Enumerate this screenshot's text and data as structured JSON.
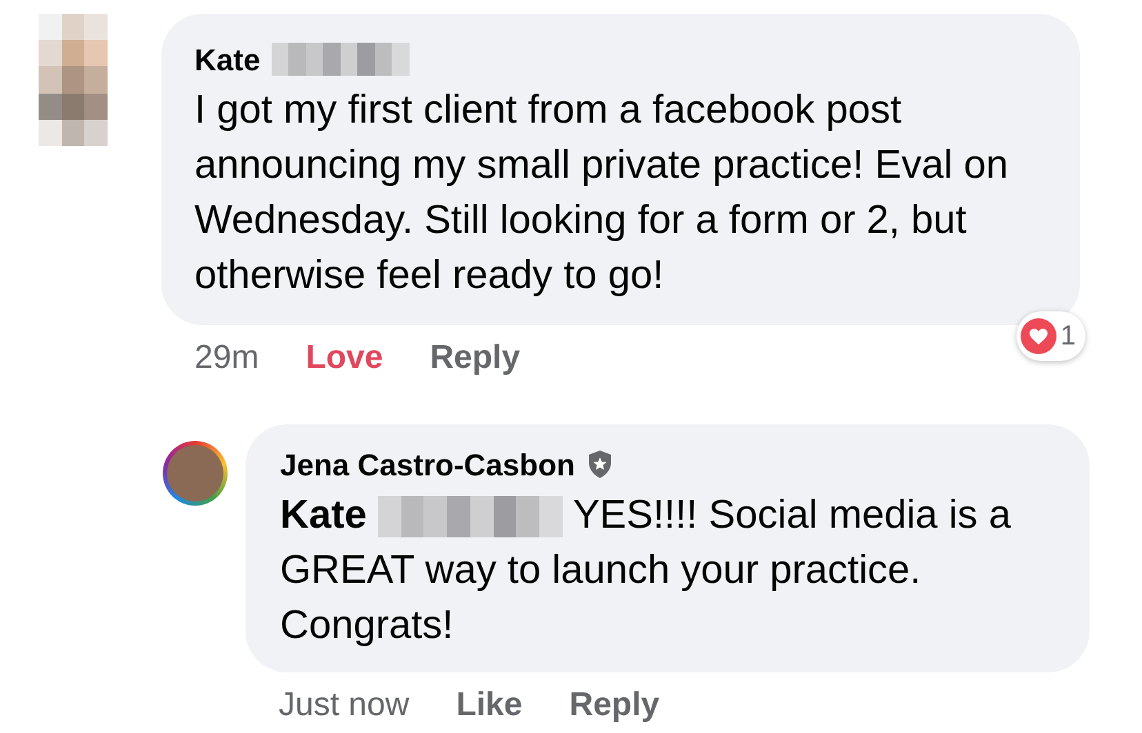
{
  "comments": [
    {
      "author": "Kate",
      "author_redacted": true,
      "badge": false,
      "text": "I got my first client from a facebook post announcing my small private practice! Eval on Wednesday. Still looking for a form or 2, but otherwise feel ready to go!",
      "actions": [
        {
          "kind": "time",
          "label": "29m"
        },
        {
          "kind": "reaction",
          "label": "Love",
          "active": true
        },
        {
          "kind": "reply",
          "label": "Reply"
        }
      ],
      "reaction_count": "1",
      "reply": false
    },
    {
      "author": "Jena Castro-Casbon",
      "author_redacted": false,
      "badge": true,
      "mention": "Kate",
      "text": "YES!!!! Social media is a GREAT way to launch your practice. Congrats!",
      "actions": [
        {
          "kind": "time",
          "label": "Just now"
        },
        {
          "kind": "reaction",
          "label": "Like",
          "active": false
        },
        {
          "kind": "reply",
          "label": "Reply"
        }
      ],
      "reply": true
    }
  ]
}
